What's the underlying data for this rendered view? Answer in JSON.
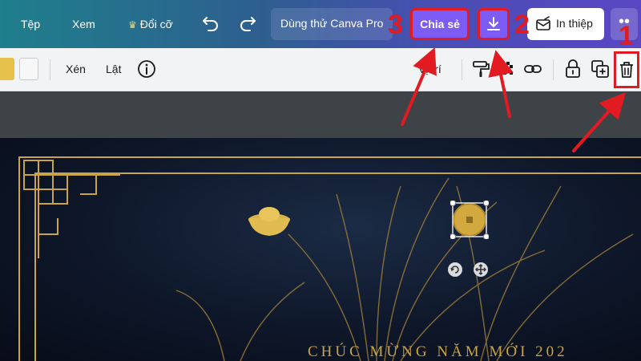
{
  "header": {
    "menu": [
      "Tệp",
      "Xem",
      "Đổi cỡ"
    ],
    "tryout_text": "Dùng thử Canva Pro",
    "share_label": "Chia sẻ",
    "print_label": "In thiệp",
    "more_label": "••"
  },
  "toolbar": {
    "crop_label": "Xén",
    "flip_label": "Lật",
    "position_label": "Vị trí"
  },
  "design": {
    "greeting": "CHÚC MỪNG NĂM MỚI 202"
  },
  "annotations": {
    "labels": [
      "1",
      "2",
      "3"
    ],
    "color": "#e21a22"
  },
  "colors": {
    "share_button": "#7d5cf5",
    "gold": "#c9a446"
  },
  "icons": [
    "crown-icon",
    "undo-icon",
    "redo-icon",
    "download-icon",
    "print-icon",
    "info-icon",
    "paint-roller-icon",
    "transparency-icon",
    "link-icon",
    "lock-icon",
    "duplicate-icon",
    "trash-icon",
    "rotate-icon",
    "move-icon"
  ]
}
